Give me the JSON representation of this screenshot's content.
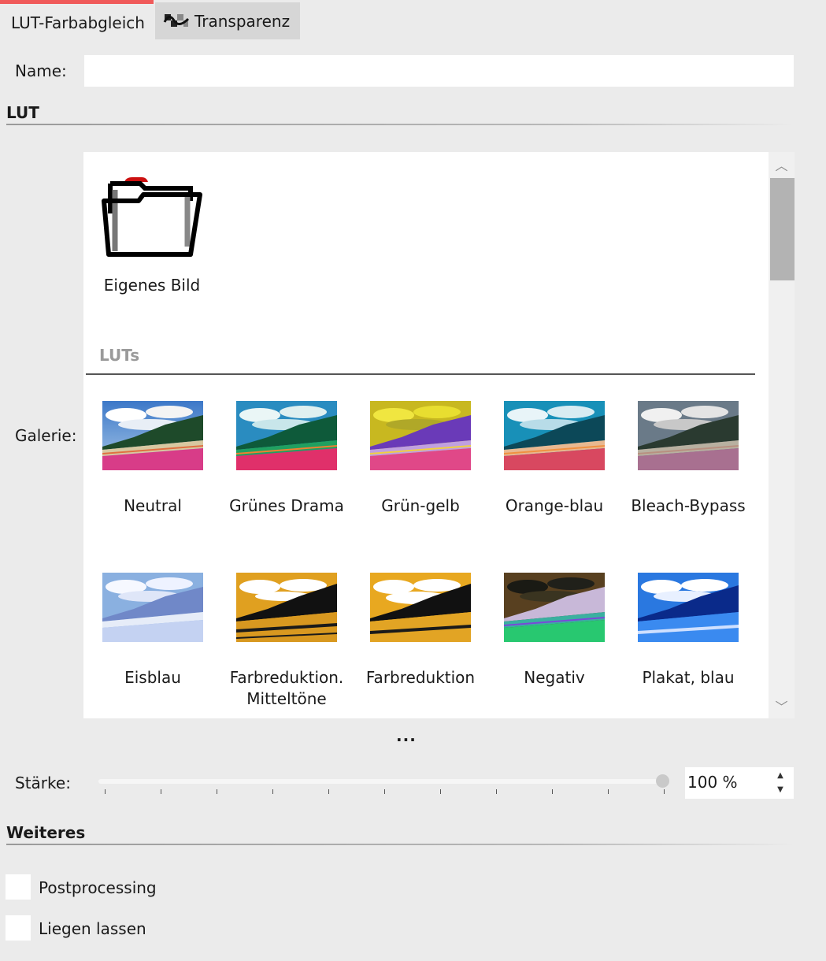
{
  "tabs": [
    {
      "label": "LUT-Farbabgleich",
      "active": true
    },
    {
      "label": "Transparenz",
      "active": false
    }
  ],
  "name": {
    "label": "Name:",
    "value": ""
  },
  "lut_section": {
    "title": "LUT"
  },
  "gallery": {
    "label": "Galerie:",
    "custom_image_label": "Eigenes Bild",
    "group_header": "LUTs",
    "items": [
      {
        "label": "Neutral"
      },
      {
        "label": "Grünes Drama"
      },
      {
        "label": "Grün-gelb"
      },
      {
        "label": "Orange-blau"
      },
      {
        "label": "Bleach-Bypass"
      },
      {
        "label": "Eisblau"
      },
      {
        "label": "Farbreduktion. Mitteltöne"
      },
      {
        "label": "Farbreduktion"
      },
      {
        "label": "Negativ"
      },
      {
        "label": "Plakat, blau"
      }
    ],
    "more": "..."
  },
  "strength": {
    "label": "Stärke:",
    "value": "100 %",
    "fraction": 1.0
  },
  "more_section": {
    "title": "Weiteres"
  },
  "options": [
    {
      "label": "Postprocessing",
      "checked": false
    },
    {
      "label": "Liegen lassen",
      "checked": false
    }
  ],
  "colors": {
    "accent": "#f05a5a"
  }
}
